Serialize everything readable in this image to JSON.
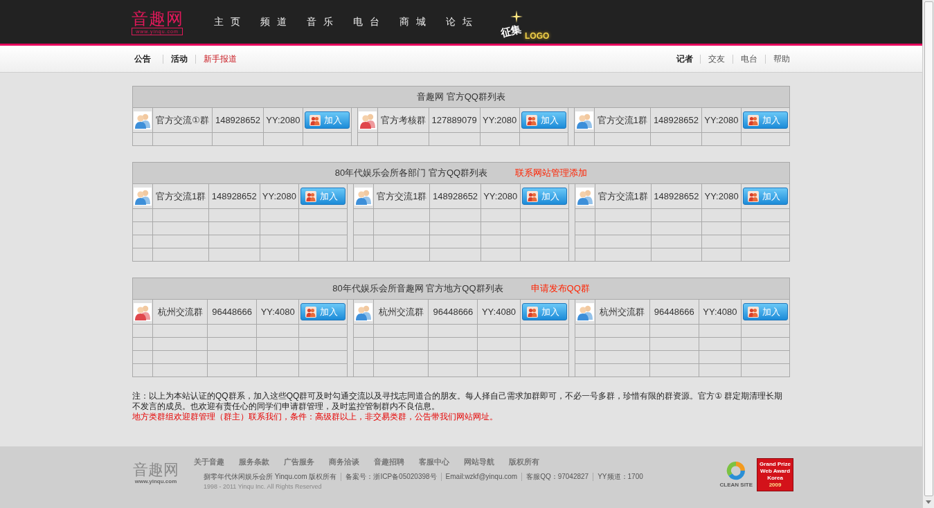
{
  "header": {
    "logo": {
      "name": "音趣网",
      "url": "www.yinqu.com"
    },
    "nav": [
      {
        "label": "主页"
      },
      {
        "label": "频道"
      },
      {
        "label": "音乐"
      },
      {
        "label": "电台"
      },
      {
        "label": "商城"
      },
      {
        "label": "论坛"
      }
    ],
    "promo": {
      "title": "征集",
      "subtitle": "LOGO"
    }
  },
  "subnav": {
    "left": [
      {
        "label": "公告",
        "kind": "bold"
      },
      {
        "label": "活动",
        "kind": "bold"
      },
      {
        "label": "新手报道",
        "kind": "highlight"
      }
    ],
    "right": [
      {
        "label": "记者",
        "kind": "bold"
      },
      {
        "label": "交友",
        "kind": "plain"
      },
      {
        "label": "电台",
        "kind": "plain"
      },
      {
        "label": "帮助",
        "kind": "plain"
      }
    ]
  },
  "tables": [
    {
      "title": "音趣网 官方QQ群列表",
      "rows": [
        [
          {
            "color": "#3d8fd9",
            "name": "官方交流①群",
            "number": "148928652",
            "yy": "YY:2080",
            "button": "加入"
          },
          {
            "color": "#e0474c",
            "name": "官方考核群",
            "number": "127889079",
            "yy": "YY:2080",
            "button": "加入"
          },
          {
            "color": "#3d8fd9",
            "name": "官方交流1群",
            "number": "148928652",
            "yy": "YY:2080",
            "button": "加入"
          }
        ],
        [
          null,
          null,
          null
        ]
      ]
    },
    {
      "title": "80年代娱乐会所各部门 官方QQ群列表",
      "link": "联系网站管理添加",
      "rows": [
        [
          {
            "color": "#3d8fd9",
            "name": "官方交流1群",
            "number": "148928652",
            "yy": "YY:2080",
            "button": "加入"
          },
          {
            "color": "#3d8fd9",
            "name": "官方交流1群",
            "number": "148928652",
            "yy": "YY:2080",
            "button": "加入"
          },
          {
            "color": "#3d8fd9",
            "name": "官方交流1群",
            "number": "148928652",
            "yy": "YY:2080",
            "button": "加入"
          }
        ],
        [
          null,
          null,
          null
        ],
        [
          null,
          null,
          null
        ],
        [
          null,
          null,
          null
        ],
        [
          null,
          null,
          null
        ]
      ]
    },
    {
      "title": "80年代娱乐会所音趣网 官方地方QQ群列表",
      "link": "申请发布QQ群",
      "rows": [
        [
          {
            "color": "#e0474c",
            "name": "杭州交流群",
            "number": "96448666",
            "yy": "YY:4080",
            "button": "加入"
          },
          {
            "color": "#3d8fd9",
            "name": "杭州交流群",
            "number": "96448666",
            "yy": "YY:4080",
            "button": "加入"
          },
          {
            "color": "#3d8fd9",
            "name": "杭州交流群",
            "number": "96448666",
            "yy": "YY:4080",
            "button": "加入"
          }
        ],
        [
          null,
          null,
          null
        ],
        [
          null,
          null,
          null
        ],
        [
          null,
          null,
          null
        ],
        [
          null,
          null,
          null
        ]
      ]
    }
  ],
  "note": {
    "text": "注：以上为本站认证的QQ群系，加入这些QQ群可及时勾通交流以及寻找志同道合的朋友。每人择自己需求加群即可，不必一号多群，珍惜有限的群资源。官方① 群定期清理长期不发言的成员。也欢迎有责任心的同学们申请群管理，及时监控管制群内不良信息。",
    "highlight": "地方类群组欢迎群管理（群主）联系我们，条件：高级群以上，非交易类群，公告带我们网站网址。"
  },
  "footer": {
    "logo": {
      "name": "音趣网",
      "url": "www.yinqu.com"
    },
    "links": [
      "关于音趣",
      "服务条款",
      "广告服务",
      "商务洽谈",
      "音趣招聘",
      "客服中心",
      "网站导航",
      "版权所有"
    ],
    "info": [
      "捌零年代休闲娱乐会所 Yinqu.com 版权所有",
      "备案号：浙ICP备05020398号",
      "Email:wzkf@yinqu.com",
      "客服QQ：97042827",
      "YY频道：1700"
    ],
    "copyright": "1998 - 2011 Yinqu Inc. All Rights Reserved",
    "clean_site": "CLEAN SITE",
    "award": [
      "Grand Prize",
      "Web Award",
      "Korea",
      "2009"
    ]
  }
}
